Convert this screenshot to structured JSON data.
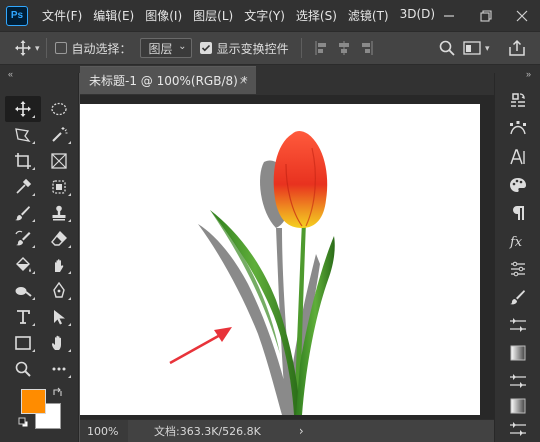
{
  "app": {
    "logo_text": "Ps",
    "menu": [
      "文件(F)",
      "编辑(E)",
      "图像(I)",
      "图层(L)",
      "文字(Y)",
      "选择(S)",
      "滤镜(T)",
      "3D(D)"
    ]
  },
  "options_bar": {
    "auto_select_label": "自动选择：",
    "auto_select_checked": false,
    "layer_dropdown_value": "图层",
    "show_transform_label": "显示变换控件",
    "show_transform_checked": true
  },
  "document": {
    "tab_title": "未标题-1 @ 100%(RGB/8) *",
    "close_symbol": "×"
  },
  "status": {
    "zoom": "100%",
    "doc_info": "文档:363.3K/526.8K",
    "arrow": "›"
  },
  "colors": {
    "foreground": "#ff8c00",
    "background": "#ffffff",
    "accent": "#31a8ff",
    "annotation_arrow": "#e8333a"
  },
  "tools": [
    "move-tool",
    "marquee-tool",
    "lasso-tool",
    "quick-select-tool",
    "crop-tool",
    "frame-tool",
    "eyedropper-tool",
    "spot-heal-tool",
    "brush-tool",
    "stamp-tool",
    "history-brush-tool",
    "eraser-tool",
    "bucket-tool",
    "smudge-tool",
    "dodge-tool",
    "pen-tool",
    "type-tool",
    "path-select-tool",
    "rectangle-tool",
    "hand-tool",
    "zoom-tool",
    "more-tools"
  ],
  "right_panel": [
    "history-icon",
    "paths-icon",
    "character-icon",
    "swatches-icon",
    "paragraph-icon",
    "fx-icon",
    "adjustments-icon",
    "brush-icon",
    "levels-icon",
    "gradient-icon",
    "properties-icon",
    "gradient2-icon",
    "properties2-icon"
  ]
}
